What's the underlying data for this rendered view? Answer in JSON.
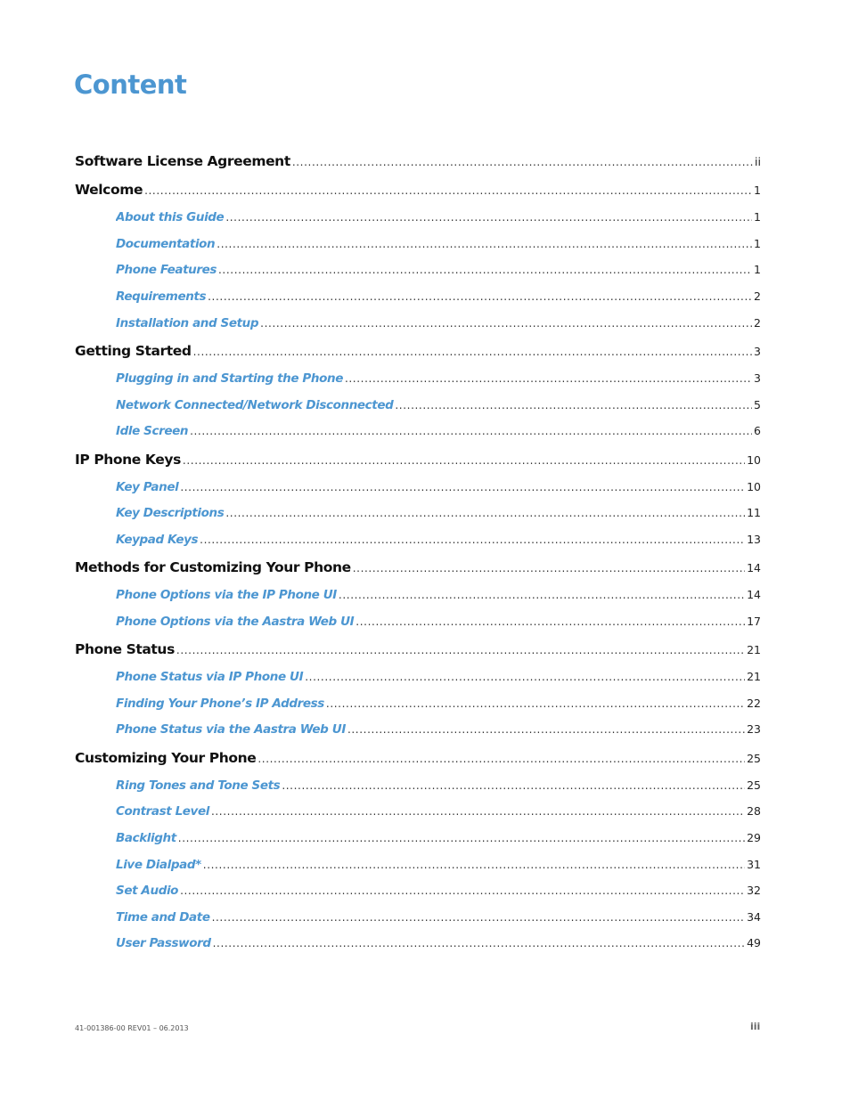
{
  "page_title": "Content",
  "colors": {
    "accent": "#4c96d1",
    "heading": "#111111"
  },
  "toc": [
    {
      "level": 1,
      "label": "Software License Agreement",
      "page": "ii"
    },
    {
      "level": 1,
      "label": "Welcome",
      "page": "1"
    },
    {
      "level": 2,
      "label": "About this Guide",
      "page": "1"
    },
    {
      "level": 2,
      "label": "Documentation",
      "page": "1"
    },
    {
      "level": 2,
      "label": "Phone Features",
      "page": "1"
    },
    {
      "level": 2,
      "label": "Requirements",
      "page": "2"
    },
    {
      "level": 2,
      "label": "Installation and Setup",
      "page": "2"
    },
    {
      "level": 1,
      "label": "Getting Started",
      "page": "3"
    },
    {
      "level": 2,
      "label": "Plugging in and Starting the Phone",
      "page": "3"
    },
    {
      "level": 2,
      "label": "Network Connected/Network Disconnected",
      "page": "5"
    },
    {
      "level": 2,
      "label": "Idle Screen",
      "page": "6"
    },
    {
      "level": 1,
      "label": "IP Phone Keys",
      "page": "10"
    },
    {
      "level": 2,
      "label": "Key Panel",
      "page": "10"
    },
    {
      "level": 2,
      "label": "Key Descriptions",
      "page": "11"
    },
    {
      "level": 2,
      "label": "Keypad Keys",
      "page": "13"
    },
    {
      "level": 1,
      "label": "Methods for Customizing Your Phone",
      "page": "14"
    },
    {
      "level": 2,
      "label": "Phone Options via the IP Phone UI",
      "page": "14"
    },
    {
      "level": 2,
      "label": "Phone Options via the Aastra Web UI",
      "page": "17"
    },
    {
      "level": 1,
      "label": "Phone Status",
      "page": "21"
    },
    {
      "level": 2,
      "label": "Phone Status via IP Phone UI",
      "page": "21"
    },
    {
      "level": 2,
      "label": "Finding Your Phone’s IP Address",
      "page": "22"
    },
    {
      "level": 2,
      "label": "Phone Status via the Aastra Web UI",
      "page": "23"
    },
    {
      "level": 1,
      "label": "Customizing Your Phone",
      "page": "25"
    },
    {
      "level": 2,
      "label": "Ring Tones and Tone Sets",
      "page": "25"
    },
    {
      "level": 2,
      "label": "Contrast Level",
      "page": "28"
    },
    {
      "level": 2,
      "label": "Backlight",
      "page": "29"
    },
    {
      "level": 2,
      "label": "Live Dialpad*",
      "page": "31"
    },
    {
      "level": 2,
      "label": "Set Audio",
      "page": "32"
    },
    {
      "level": 2,
      "label": "Time and Date",
      "page": "34"
    },
    {
      "level": 2,
      "label": "User Password",
      "page": "49"
    }
  ],
  "footer": {
    "doc_id": "41-001386-00 REV01 – 06.2013",
    "page_number": "iii"
  }
}
